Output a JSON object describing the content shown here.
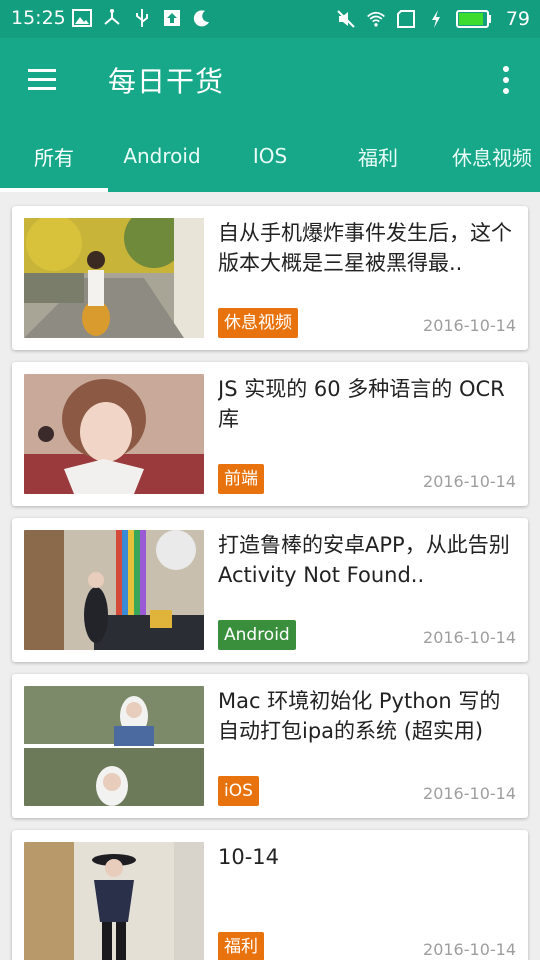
{
  "status_bar": {
    "time": "15:25",
    "battery": "79",
    "icons_left": [
      "image-icon",
      "usb-share-icon",
      "usb-icon",
      "upload-icon",
      "moon-icon"
    ],
    "icons_right": [
      "mute-icon",
      "wifi-icon",
      "sim-icon",
      "charging-icon",
      "battery-icon"
    ]
  },
  "toolbar": {
    "title": "每日干货",
    "menu_icon": "hamburger-menu-icon",
    "more_icon": "more-vertical-icon"
  },
  "tabs": [
    {
      "label": "所有",
      "selected": true
    },
    {
      "label": "Android",
      "selected": false
    },
    {
      "label": "IOS",
      "selected": false
    },
    {
      "label": "福利",
      "selected": false
    },
    {
      "label": "休息视频",
      "selected": false
    }
  ],
  "colors": {
    "primary": "#16a889",
    "status_bar": "#139e7f",
    "tag_orange": "#e8730e",
    "tag_green": "#3a8f3d"
  },
  "cards": [
    {
      "title": "自从手机爆炸事件发生后，这个版本大概是三星被黑得最..",
      "tag": "休息视频",
      "tag_color": "#e8730e",
      "date": "2016-10-14"
    },
    {
      "title": "JS 实现的 60 多种语言的 OCR 库",
      "tag": "前端",
      "tag_color": "#e8730e",
      "date": "2016-10-14"
    },
    {
      "title": "打造鲁棒的安卓APP，从此告别 Activity Not Found..",
      "tag": "Android",
      "tag_color": "#3a8f3d",
      "date": "2016-10-14"
    },
    {
      "title": "Mac 环境初始化 Python 写的自动打包ipa的系统 (超实用)",
      "tag": "iOS",
      "tag_color": "#e8730e",
      "date": "2016-10-14"
    },
    {
      "title": "10-14",
      "tag": "福利",
      "tag_color": "#e8730e",
      "date": "2016-10-14"
    }
  ]
}
